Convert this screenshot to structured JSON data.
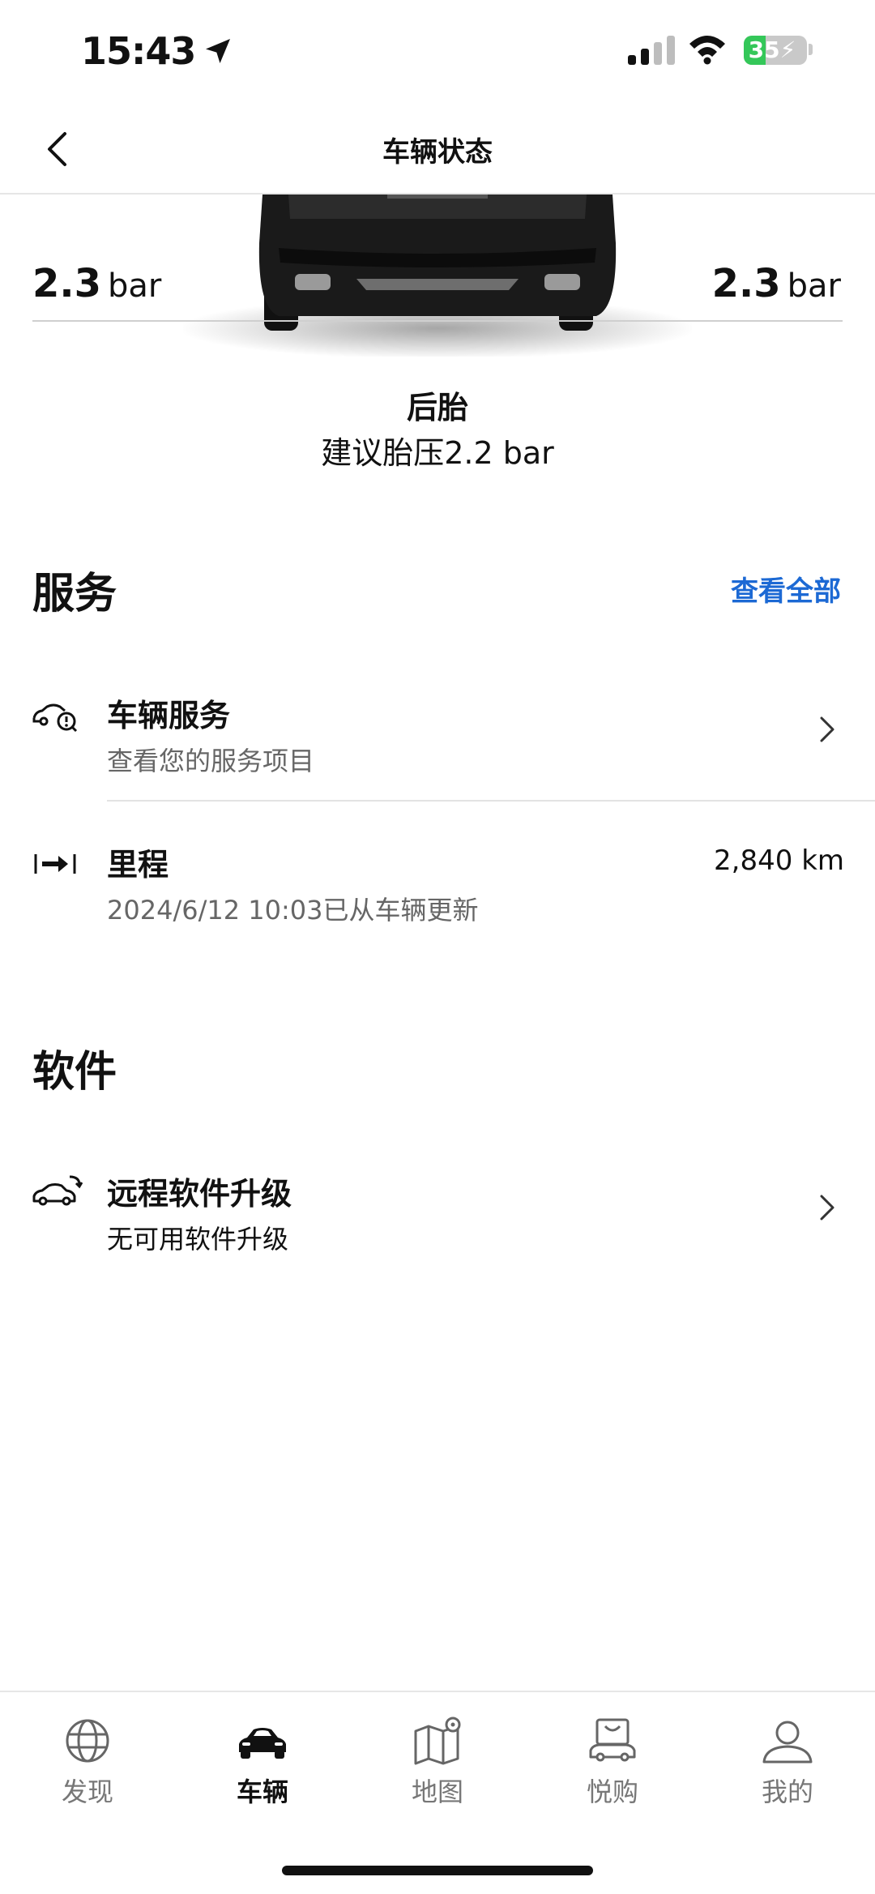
{
  "status_bar": {
    "time": "15:43",
    "battery": "35"
  },
  "nav": {
    "title": "车辆状态"
  },
  "tyres": {
    "rear_left": {
      "value": "2.3",
      "unit": "bar"
    },
    "rear_right": {
      "value": "2.3",
      "unit": "bar"
    },
    "label": "后胎",
    "recommendation": "建议胎压2.2 bar"
  },
  "services": {
    "section_title": "服务",
    "view_all": "查看全部",
    "vehicle_service": {
      "title": "车辆服务",
      "subtitle": "查看您的服务项目"
    },
    "mileage": {
      "title": "里程",
      "subtitle": "2024/6/12 10:03已从车辆更新",
      "value": "2,840 km"
    }
  },
  "software": {
    "section_title": "软件",
    "remote_upgrade": {
      "title": "远程软件升级",
      "subtitle": "无可用软件升级"
    }
  },
  "tab_bar": {
    "items": [
      {
        "label": "发现",
        "icon": "globe-icon"
      },
      {
        "label": "车辆",
        "icon": "car-icon",
        "active": true
      },
      {
        "label": "地图",
        "icon": "map-icon"
      },
      {
        "label": "悦购",
        "icon": "shop-car-icon"
      },
      {
        "label": "我的",
        "icon": "profile-icon"
      }
    ]
  },
  "colors": {
    "accent": "#1c69d4",
    "battery": "#34c759"
  }
}
